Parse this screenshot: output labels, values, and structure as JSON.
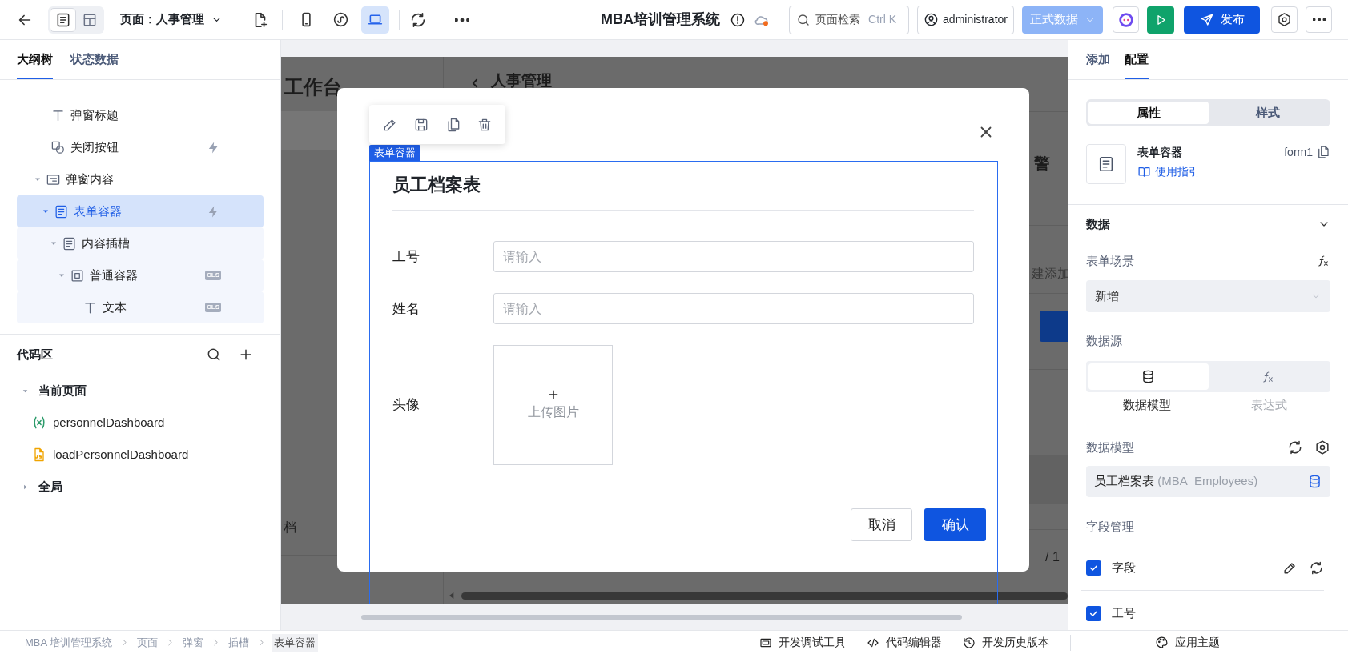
{
  "toolbar": {
    "view_modes": [
      {
        "kind": "outline",
        "selected": true
      },
      {
        "kind": "layout",
        "selected": false
      }
    ],
    "page_selector": "页面：人事管理",
    "devices": [
      {
        "kind": "mobile",
        "selected": false
      },
      {
        "kind": "miniprogram",
        "selected": false
      },
      {
        "kind": "desktop",
        "selected": true
      }
    ],
    "app_title": "MBA培训管理系统",
    "search": {
      "label": "页面检索",
      "shortcut": "Ctrl K"
    },
    "user": "administrator",
    "environment": "正式数据",
    "publish": "发布"
  },
  "left_tabs": [
    {
      "label": "大纲树",
      "selected": true
    },
    {
      "label": "状态数据",
      "selected": false
    }
  ],
  "outline_tree": [
    {
      "kind": "text",
      "label": "弹窗标题",
      "selected": false,
      "highlighted": false
    },
    {
      "kind": "button",
      "label": "关闭按钮",
      "selected": false,
      "highlighted": false,
      "event": true
    },
    {
      "kind": "panel",
      "label": "弹窗内容",
      "selected": false,
      "highlighted": false,
      "expanded": true,
      "children": [
        {
          "kind": "form",
          "label": "表单容器",
          "selected": true,
          "event": true,
          "expanded": true,
          "children": [
            {
              "kind": "form",
              "label": "内容插槽",
              "selected": false,
              "highlighted": true,
              "expanded": true,
              "children": [
                {
                  "kind": "container",
                  "label": "普通容器",
                  "selected": false,
                  "highlighted": true,
                  "badge": "CLS",
                  "expanded": true,
                  "children": [
                    {
                      "kind": "text",
                      "label": "文本",
                      "selected": false,
                      "highlighted": true,
                      "badge": "CLS"
                    }
                  ]
                }
              ]
            }
          ]
        }
      ]
    }
  ],
  "code_area": {
    "title": "代码区",
    "groups": [
      {
        "label": "当前页面",
        "expanded": true,
        "items": [
          {
            "kind": "variable",
            "name": "personnelDashboard"
          },
          {
            "kind": "script",
            "name": "loadPersonnelDashboard"
          }
        ]
      },
      {
        "label": "全局",
        "expanded": false
      }
    ]
  },
  "background_page": {
    "title": "工作台",
    "header": "人事管理",
    "card_title": "警",
    "search_hint": "建添加",
    "list_item": "档",
    "pagination": "/ 1"
  },
  "selection_label": "表单容器",
  "form": {
    "title": "员工档案表",
    "fields": [
      {
        "kind": "input",
        "label": "工号",
        "placeholder": "请输入"
      },
      {
        "kind": "input",
        "label": "姓名",
        "placeholder": "请输入"
      },
      {
        "kind": "upload",
        "label": "头像",
        "text": "上传图片"
      }
    ],
    "buttons": [
      {
        "label": "取消",
        "primary": false
      },
      {
        "label": "确认",
        "primary": true
      }
    ]
  },
  "right_tabs": [
    {
      "label": "添加",
      "selected": false
    },
    {
      "label": "配置",
      "selected": true
    }
  ],
  "config_tabs": [
    {
      "label": "属性",
      "selected": true
    },
    {
      "label": "样式",
      "selected": false
    }
  ],
  "component": {
    "name": "表单容器",
    "guide": "使用指引",
    "id": "form1"
  },
  "data_section": {
    "title": "数据",
    "expanded": true,
    "scene": {
      "label": "表单场景",
      "value": "新增"
    },
    "source": {
      "label": "数据源",
      "options": [
        {
          "kind": "model",
          "label": "数据模型",
          "selected": true
        },
        {
          "kind": "expression",
          "label": "表达式",
          "selected": false
        }
      ]
    },
    "model": {
      "label": "数据模型",
      "name": "员工档案表",
      "table": "(MBA_Employees)"
    },
    "fields": {
      "label": "字段管理",
      "items": [
        {
          "kind": "header",
          "label": "字段",
          "checked": true
        },
        {
          "kind": "field",
          "label": "工号",
          "checked": true
        }
      ]
    }
  },
  "status_bar": {
    "breadcrumb": [
      {
        "label": "MBA 培训管理系统",
        "selected": false
      },
      {
        "label": "页面",
        "selected": false
      },
      {
        "label": "弹窗",
        "selected": false
      },
      {
        "label": "插槽",
        "selected": false
      },
      {
        "label": "表单容器",
        "selected": true
      }
    ],
    "tools": [
      {
        "kind": "debug",
        "label": "开发调试工具"
      },
      {
        "kind": "code",
        "label": "代码编辑器"
      },
      {
        "kind": "history",
        "label": "开发历史版本"
      }
    ],
    "theme": "应用主题"
  }
}
